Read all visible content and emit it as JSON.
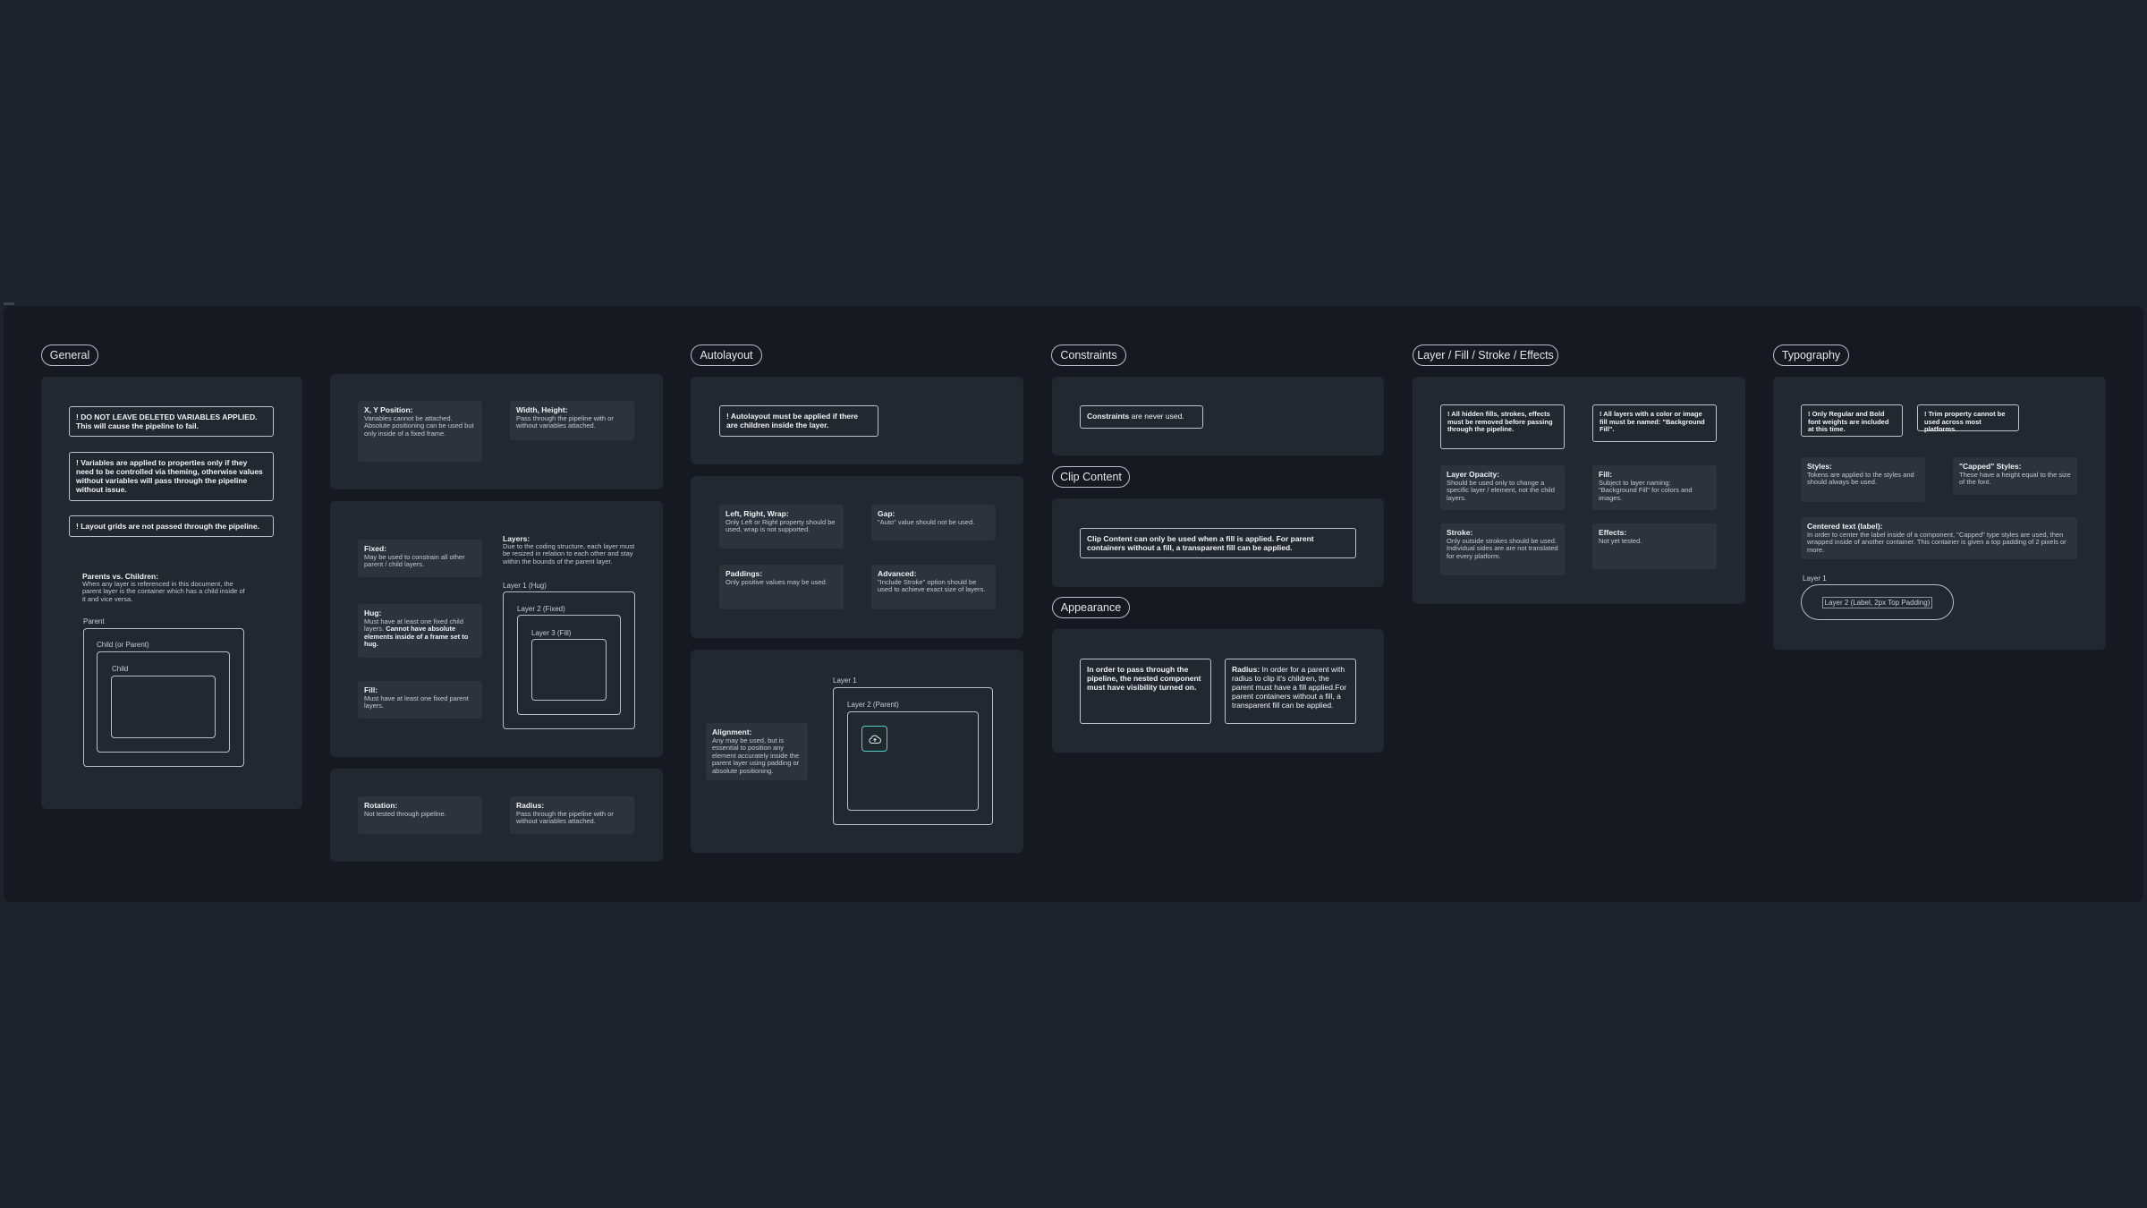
{
  "sections": {
    "general": "General",
    "autolayout": "Autolayout",
    "constraints": "Constraints",
    "clip_content": "Clip Content",
    "appearance": "Appearance",
    "layer_fill": "Layer / Fill / Stroke / Effects",
    "typography": "Typography"
  },
  "general": {
    "note1": "! DO NOT LEAVE DELETED VARIABLES APPLIED. This will cause the pipeline to fail.",
    "note2": "! Variables are applied to properties only if they need to be controlled via theming, otherwise values without variables will pass through the pipeline without issue.",
    "note3": "! Layout grids are not passed through the pipeline.",
    "pvc_title": "Parents vs. Children:",
    "pvc_text": "When any layer is referenced in this document, the parent layer is the container which has a child inside of it and vice versa.",
    "parent": "Parent",
    "child_or_parent": "Child (or Parent)",
    "child": "Child"
  },
  "sizing": {
    "xy_title": "X, Y Position:",
    "xy_text": "Variables cannot be attached. Absolute positioning can be used but only inside of a fixed frame.",
    "wh_title": "Width, Height:",
    "wh_text": "Pass through the pipeline with or without variables attached.",
    "fixed_title": "Fixed:",
    "fixed_text": "May be used to constrain all other parent / child layers.",
    "hug_title": "Hug:",
    "hug_text_a": "Must have at least one fixed child layers.",
    "hug_text_b": "Cannot have absolute elements inside of a frame set to hug.",
    "fill_title": "Fill:",
    "fill_text": "Must have at least one fixed parent layers.",
    "layers_title": "Layers:",
    "layers_text_a": "Due to the coding structure, each layer must be resized in relation to each other",
    "layers_text_b": "and stay within the bounds of the parent layer.",
    "layer1": "Layer 1 (Hug)",
    "layer2": "Layer 2 (Fixed)",
    "layer3": "Layer 3 (Fill)",
    "rotation_title": "Rotation:",
    "rotation_text": "Not tested through pipeline.",
    "radius_title": "Radius:",
    "radius_text": "Pass through the pipeline with or without variables attached."
  },
  "autolayout": {
    "note": "! Autolayout must be applied if there are children inside the layer.",
    "lrw_title": "Left, Right, Wrap:",
    "lrw_text": "Only Left or Right property should be used, wrap is not supported.",
    "gap_title": "Gap:",
    "gap_text": "\"Auto\" value should not be used.",
    "pad_title": "Paddings:",
    "pad_text": "Only positive values may be used.",
    "adv_title": "Advanced:",
    "adv_text": "\"Include Stroke\" option should be used to achieve exact size of layers.",
    "align_title": "Alignment:",
    "align_text": "Any may be used, but is essential to position any element accurately inside the parent layer using padding or absolute positioning.",
    "layer1": "Layer 1",
    "layer2": "Layer 2 (Parent)"
  },
  "constraints": {
    "bold": "Constraints",
    "text": " are never used."
  },
  "clip": {
    "text": "Clip Content can only be used when a fill is applied. For parent containers without a fill, a transparent fill can be applied."
  },
  "appearance": {
    "visibility_text": "In order to pass through the pipeline, the nested component must have visibility turned on.",
    "radius_bold": "Radius:",
    "radius_text": " In order for a parent with radius to clip it's children, the parent must have a fill applied.For parent containers without a fill, a transparent fill can be applied."
  },
  "layerfill": {
    "note1": "! All hidden fills, strokes, effects must be removed before passing through the pipeline.",
    "note2": "! All layers with a color or image fill must be named: \"Background Fill\".",
    "opacity_title": "Layer Opacity:",
    "opacity_text": "Should be used only to change a specific layer / element, not the child layers.",
    "fill_title": "Fill:",
    "fill_text": "Subject to layer naming: \"Background Fill\" for colors and images.",
    "stroke_title": "Stroke:",
    "stroke_text": "Only outside strokes should be used. Individual sides are are not translated for every platform.",
    "effects_title": "Effects:",
    "effects_text": "Not yet tested."
  },
  "typography": {
    "note1": "! Only Regular and Bold font weights are included at this time.",
    "note2": "! Trim property cannot be used across most platforms.",
    "styles_title": "Styles:",
    "styles_text": "Tokens are applied to the styles and should always be used.",
    "capped_title": "\"Capped\" Styles:",
    "capped_text": "These have a height equal to the size of the font.",
    "centered_title": "Centered text (label):",
    "centered_text": "In order to center the label inside of a component, \"Capped\" type styles are used, then wrapped inside of another container. This container is given a top padding of 2 pixels or more.",
    "layer1": "Layer 1",
    "layer2": "Layer 2 (Label, 2px Top Padding)"
  },
  "colors": {
    "background": "#1e232b",
    "frame": "#161a20",
    "panel": "#222830",
    "card": "#2c333d",
    "accent": "#4fd1c5"
  },
  "icons": [
    "upload-icon"
  ]
}
